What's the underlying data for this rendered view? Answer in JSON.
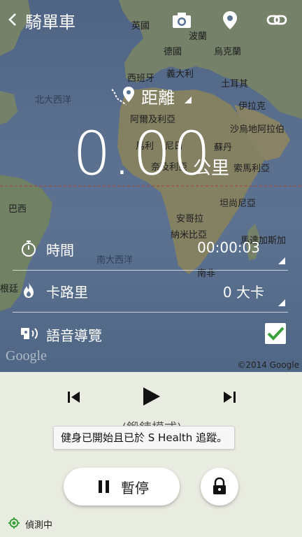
{
  "header": {
    "title": "騎單車",
    "icons": [
      "back-icon",
      "camera-icon",
      "location-pin-icon",
      "link-icon"
    ]
  },
  "map": {
    "labels": {
      "uk": "英國",
      "poland": "波蘭",
      "germany": "德國",
      "ukraine": "烏克蘭",
      "italy": "義大利",
      "spain": "西班牙",
      "turkey": "土耳其",
      "north_atlantic": "北大西洋",
      "iraq": "伊拉克",
      "algeria": "阿爾及利亞",
      "saudi": "沙烏地阿拉伯",
      "mali": "馬利",
      "niger": "尼日",
      "sudan": "蘇丹",
      "nigeria": "奈及利亞",
      "somalia": "索馬利亞",
      "brazil": "巴西",
      "tanzania": "坦尚尼亞",
      "angola": "安哥拉",
      "namibia": "納米比亞",
      "madagascar": "馬達加斯加",
      "south_atlantic": "南大西洋",
      "south_africa": "南非",
      "argentina_partial": "根廷"
    },
    "watermark": "Google",
    "copyright": "©2014 Google"
  },
  "stats": {
    "distance_label": "距離",
    "distance_value": "0.00",
    "distance_unit": "公里",
    "time_label": "時間",
    "time_value": "00:00:03",
    "calories_label": "卡路里",
    "calories_value": "0 大卡",
    "voice_label": "語音導覽",
    "voice_checked": true
  },
  "controls": {
    "ghost_text": "(鍛鍊模式)",
    "toast": "健身已開始且已於 S Health 追蹤。",
    "pause_label": "暫停",
    "gps_label": "偵測中"
  },
  "colors": {
    "accent_green": "#3aa13a",
    "map_water": "#6b82a3",
    "map_land": "#8b9a6e",
    "panel_bg": "#e9ece1"
  }
}
